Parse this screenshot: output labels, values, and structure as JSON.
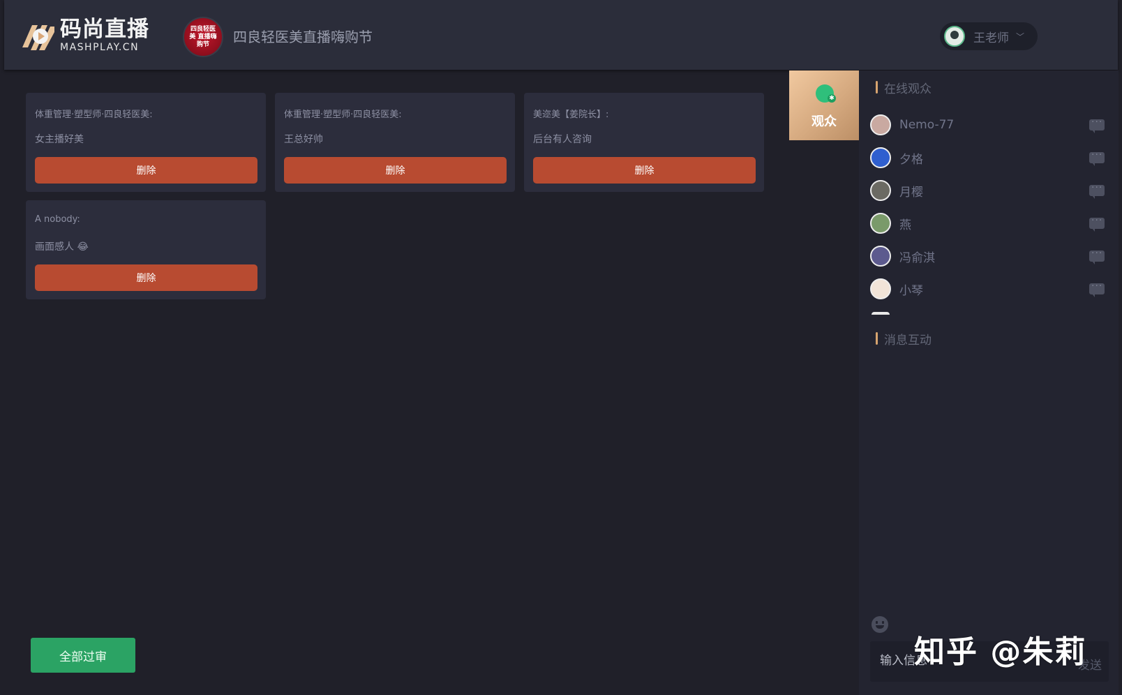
{
  "header": {
    "logo_cn": "码尚直播",
    "logo_en": "MASHPLAY.CN",
    "room_avatar_text": "四良轻医美 直播嗨购节",
    "room_title": "四良轻医美直播嗨购节",
    "user_name": "王老师",
    "user_menu_icon": "chevron-down-icon"
  },
  "comments": [
    {
      "name": "体重管理·塑型师·四良轻医美:",
      "message": "女主播好美",
      "delete_label": "删除"
    },
    {
      "name": "体重管理·塑型师·四良轻医美:",
      "message": "王总好帅",
      "delete_label": "删除"
    },
    {
      "name": "美迩美【姜院长】:",
      "message": "后台有人咨询",
      "delete_label": "删除"
    },
    {
      "name": "A nobody:",
      "message": "画面感人 😂",
      "delete_label": "删除"
    }
  ],
  "approve_all_label": "全部过审",
  "sidebar": {
    "tab_label": "观众",
    "tab_icon": "user-group-icon",
    "online_title": "在线观众",
    "viewers": [
      {
        "name": "Nemo-77",
        "avatar_color": "#c9a9a1"
      },
      {
        "name": "夕格",
        "avatar_color": "#2f5fcf"
      },
      {
        "name": "月樱",
        "avatar_color": "#6b6a63"
      },
      {
        "name": "燕",
        "avatar_color": "#7a9a6a"
      },
      {
        "name": "冯俞淇",
        "avatar_color": "#5c5a8e"
      },
      {
        "name": "小琴",
        "avatar_color": "#f1e4d8"
      }
    ],
    "message_title": "消息互动",
    "input_placeholder": "输入信息",
    "send_label": "发送"
  },
  "watermark": "知乎 @朱莉",
  "colors": {
    "accent_delete": "#b84b31",
    "accent_approve": "#2ba364",
    "accent_tab": "#d7a46f"
  }
}
